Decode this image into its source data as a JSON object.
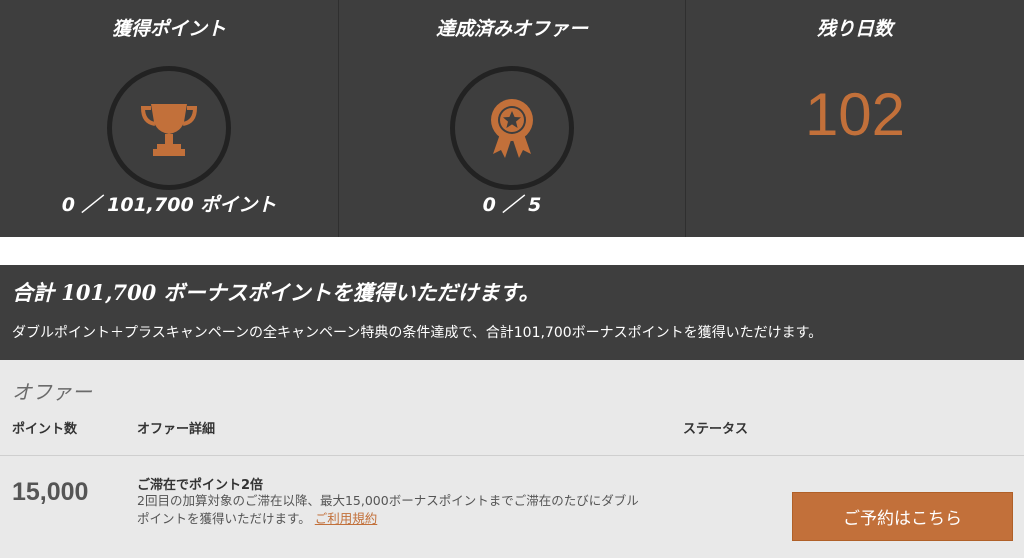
{
  "stats": {
    "points": {
      "title": "獲得ポイント",
      "icon": "trophy-icon",
      "value": "0 ／ 101,700 ポイント"
    },
    "offers": {
      "title": "達成済みオファー",
      "icon": "award-badge-icon",
      "value": "0 ／ 5"
    },
    "days": {
      "title": "残り日数",
      "value": "102"
    }
  },
  "banner": {
    "title": "合計 101,700 ボーナスポイントを獲得いただけます。",
    "text": "ダブルポイント＋プラスキャンペーンの全キャンペーン特典の条件達成で、合計101,700ボーナスポイントを獲得いただけます。"
  },
  "offers": {
    "title": "オファー",
    "columns": {
      "points": "ポイント数",
      "details": "オファー詳細",
      "status": "ステータス"
    },
    "rows": [
      {
        "points": "15,000",
        "name": "ご滞在でポイント2倍",
        "description": "2回目の加算対象のご滞在以降、最大15,000ボーナスポイントまでご滞在のたびにダブルポイントを獲得いただけます。",
        "terms_link": "ご利用規約",
        "button": "ご予約はこちら"
      }
    ]
  },
  "colors": {
    "accent": "#c2703a",
    "panel": "#3e3e3e",
    "offers_bg": "#e9e9e9"
  }
}
